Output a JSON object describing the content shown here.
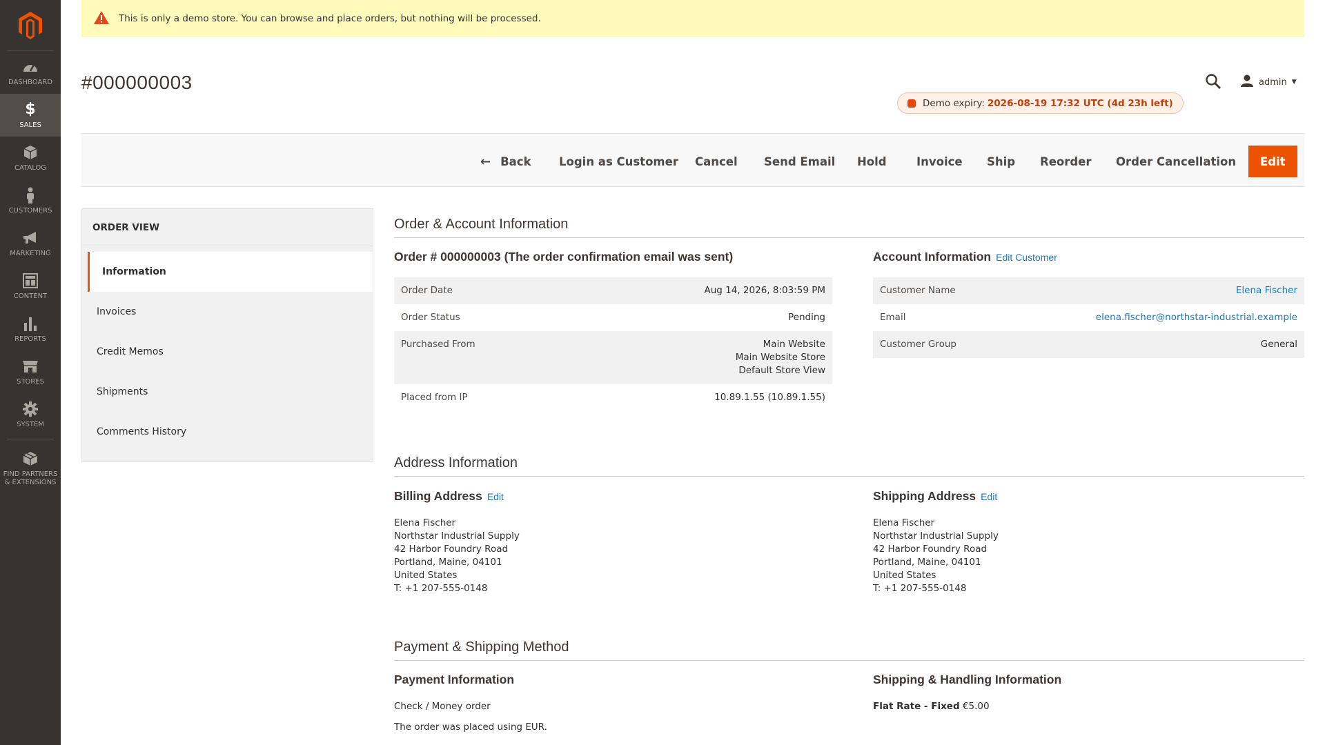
{
  "notice": {
    "text": "This is only a demo store. You can browse and place orders, but nothing will be processed."
  },
  "sidebar": {
    "items": [
      {
        "label": "DASHBOARD"
      },
      {
        "label": "SALES"
      },
      {
        "label": "CATALOG"
      },
      {
        "label": "CUSTOMERS"
      },
      {
        "label": "MARKETING"
      },
      {
        "label": "CONTENT"
      },
      {
        "label": "REPORTS"
      },
      {
        "label": "STORES"
      },
      {
        "label": "SYSTEM"
      },
      {
        "label": "FIND PARTNERS & EXTENSIONS"
      }
    ]
  },
  "header": {
    "title": "#000000003",
    "user": "admin",
    "expiry_label": "Demo expiry:",
    "expiry_value": "2026-08-19 17:32 UTC (4d 23h left)"
  },
  "actions": {
    "back": "Back",
    "login_as_customer": "Login as Customer",
    "cancel": "Cancel",
    "send_email": "Send Email",
    "hold": "Hold",
    "invoice": "Invoice",
    "ship": "Ship",
    "reorder": "Reorder",
    "order_cancellation": "Order Cancellation",
    "edit": "Edit"
  },
  "order_view": {
    "heading": "ORDER VIEW",
    "tabs": [
      {
        "label": "Information"
      },
      {
        "label": "Invoices"
      },
      {
        "label": "Credit Memos"
      },
      {
        "label": "Shipments"
      },
      {
        "label": "Comments History"
      }
    ]
  },
  "order_account": {
    "section_title": "Order & Account Information",
    "order_title": "Order # 000000003 (The order confirmation email was sent)",
    "order_rows": [
      {
        "label": "Order Date",
        "value": "Aug 14, 2026, 8:03:59 PM"
      },
      {
        "label": "Order Status",
        "value": "Pending"
      },
      {
        "label": "Purchased From",
        "value_lines": [
          "Main Website",
          "Main Website Store",
          "Default Store View"
        ]
      },
      {
        "label": "Placed from IP",
        "value": "10.89.1.55 (10.89.1.55)"
      }
    ],
    "account_title": "Account Information",
    "edit_customer": "Edit Customer",
    "account_rows": [
      {
        "label": "Customer Name",
        "value": "Elena Fischer"
      },
      {
        "label": "Email",
        "value": "elena.fischer@northstar-industrial.example"
      },
      {
        "label": "Customer Group",
        "value": "General"
      }
    ]
  },
  "address_info": {
    "section_title": "Address Information",
    "billing_title": "Billing Address",
    "shipping_title": "Shipping Address",
    "edit_label": "Edit",
    "billing_lines": [
      "Elena Fischer",
      "Northstar Industrial Supply",
      "42 Harbor Foundry Road",
      "Portland, Maine, 04101",
      "United States",
      "T: +1 207-555-0148"
    ],
    "shipping_lines": [
      "Elena Fischer",
      "Northstar Industrial Supply",
      "42 Harbor Foundry Road",
      "Portland, Maine, 04101",
      "United States",
      "T: +1 207-555-0148"
    ]
  },
  "payment_shipping": {
    "section_title": "Payment & Shipping Method",
    "payment_title": "Payment Information",
    "payment_method": "Check / Money order",
    "payment_note": "The order was placed using EUR.",
    "shipping_title": "Shipping & Handling Information",
    "shipping_method": "Flat Rate - Fixed",
    "shipping_price": "€5.00"
  }
}
